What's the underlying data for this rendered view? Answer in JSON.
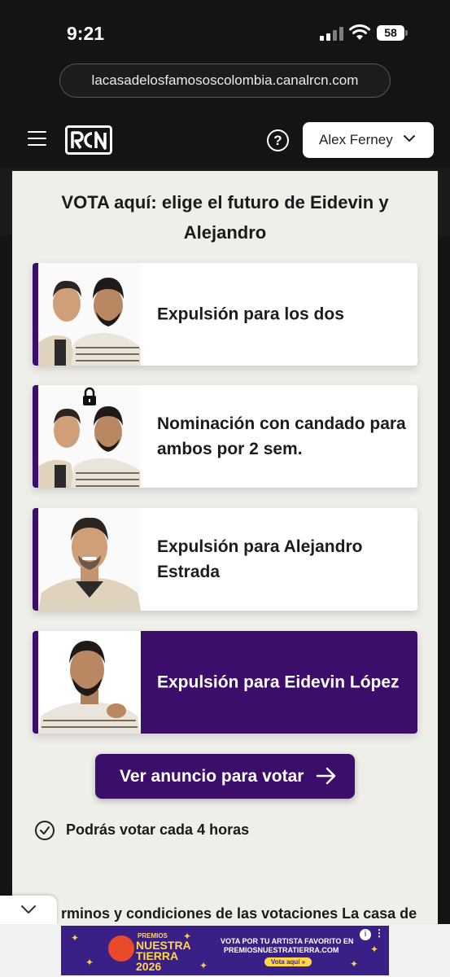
{
  "status_bar": {
    "time": "9:21",
    "battery": "58"
  },
  "browser": {
    "url": "lacasadelosfamososcolombia.canalrcn.com"
  },
  "header": {
    "brand": "RCN",
    "user_name": "Alex Ferney"
  },
  "vote": {
    "title": "VOTA aquí: elige el futuro de Eidevin y Alejandro",
    "options": [
      {
        "label": "Expulsión para los dos"
      },
      {
        "label": "Nominación con candado para ambos por 2 sem."
      },
      {
        "label": "Expulsión para Alejandro Estrada"
      },
      {
        "label": "Expulsión para Eidevin López",
        "selected": true
      }
    ],
    "cta_label": "Ver anuncio para votar",
    "note": "Podrás votar cada 4 horas",
    "terms_text": "rminos y condiciones de las votaciones La casa de"
  },
  "ad": {
    "brand_small": "PREMIOS",
    "brand": "NUESTRA TIERRA 2026",
    "line1": "VOTA POR TU ARTISTA FAVORITO EN",
    "line2": "PREMIOSNUESTRATIERRA.COM",
    "button": "Vota aquí »"
  },
  "colors": {
    "accent": "#3b0e6b",
    "background": "#141414",
    "card": "#efefea"
  }
}
